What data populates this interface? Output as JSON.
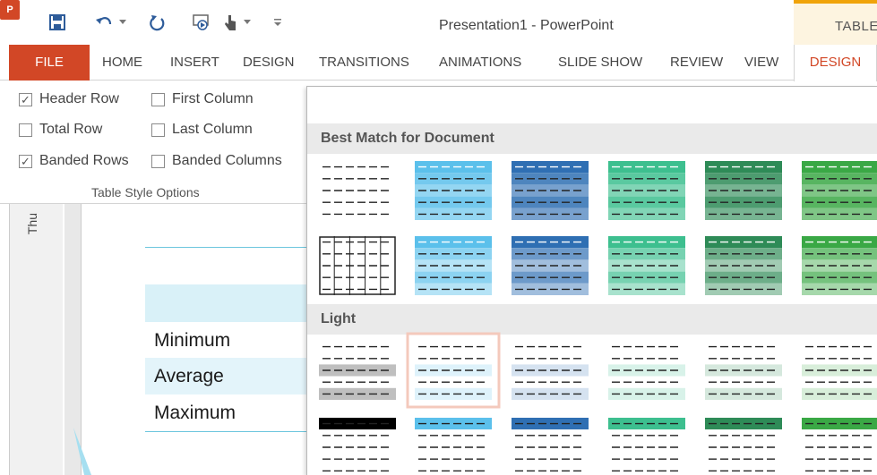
{
  "window": {
    "title": "Presentation1 - PowerPoint",
    "contextual_tab_group": "TABLE"
  },
  "qat": {
    "app_icon": "powerpoint-icon",
    "items": [
      "save-icon",
      "undo-icon",
      "dropdown-arrow-icon",
      "redo-icon",
      "start-from-beginning-icon",
      "touch-mode-icon",
      "customize-qat-icon"
    ]
  },
  "tabs": [
    {
      "label": "FILE",
      "name": "tab-file"
    },
    {
      "label": "HOME",
      "name": "tab-home"
    },
    {
      "label": "INSERT",
      "name": "tab-insert"
    },
    {
      "label": "DESIGN",
      "name": "tab-design"
    },
    {
      "label": "TRANSITIONS",
      "name": "tab-transitions"
    },
    {
      "label": "ANIMATIONS",
      "name": "tab-animations"
    },
    {
      "label": "SLIDE SHOW",
      "name": "tab-slide-show"
    },
    {
      "label": "REVIEW",
      "name": "tab-review"
    },
    {
      "label": "VIEW",
      "name": "tab-view"
    },
    {
      "label": "DESIGN",
      "name": "tab-table-design"
    }
  ],
  "table_style_options": {
    "group_label": "Table Style Options",
    "options": [
      {
        "label": "Header Row",
        "checked": true
      },
      {
        "label": "First Column",
        "checked": false
      },
      {
        "label": "Total Row",
        "checked": false
      },
      {
        "label": "Last Column",
        "checked": false
      },
      {
        "label": "Banded Rows",
        "checked": true
      },
      {
        "label": "Banded Columns",
        "checked": false
      }
    ]
  },
  "thumbnail_pane": {
    "label": "Thu"
  },
  "slide_table": {
    "rows": [
      "Minimum",
      "Average",
      "Maximum"
    ]
  },
  "gallery": {
    "sections": [
      {
        "title": "Best Match for Document"
      },
      {
        "title": "Light"
      }
    ],
    "colors": [
      "#ffffff",
      "#5bc0eb",
      "#2f6fb3",
      "#3dbf8f",
      "#2e8b57",
      "#3aa845"
    ]
  }
}
